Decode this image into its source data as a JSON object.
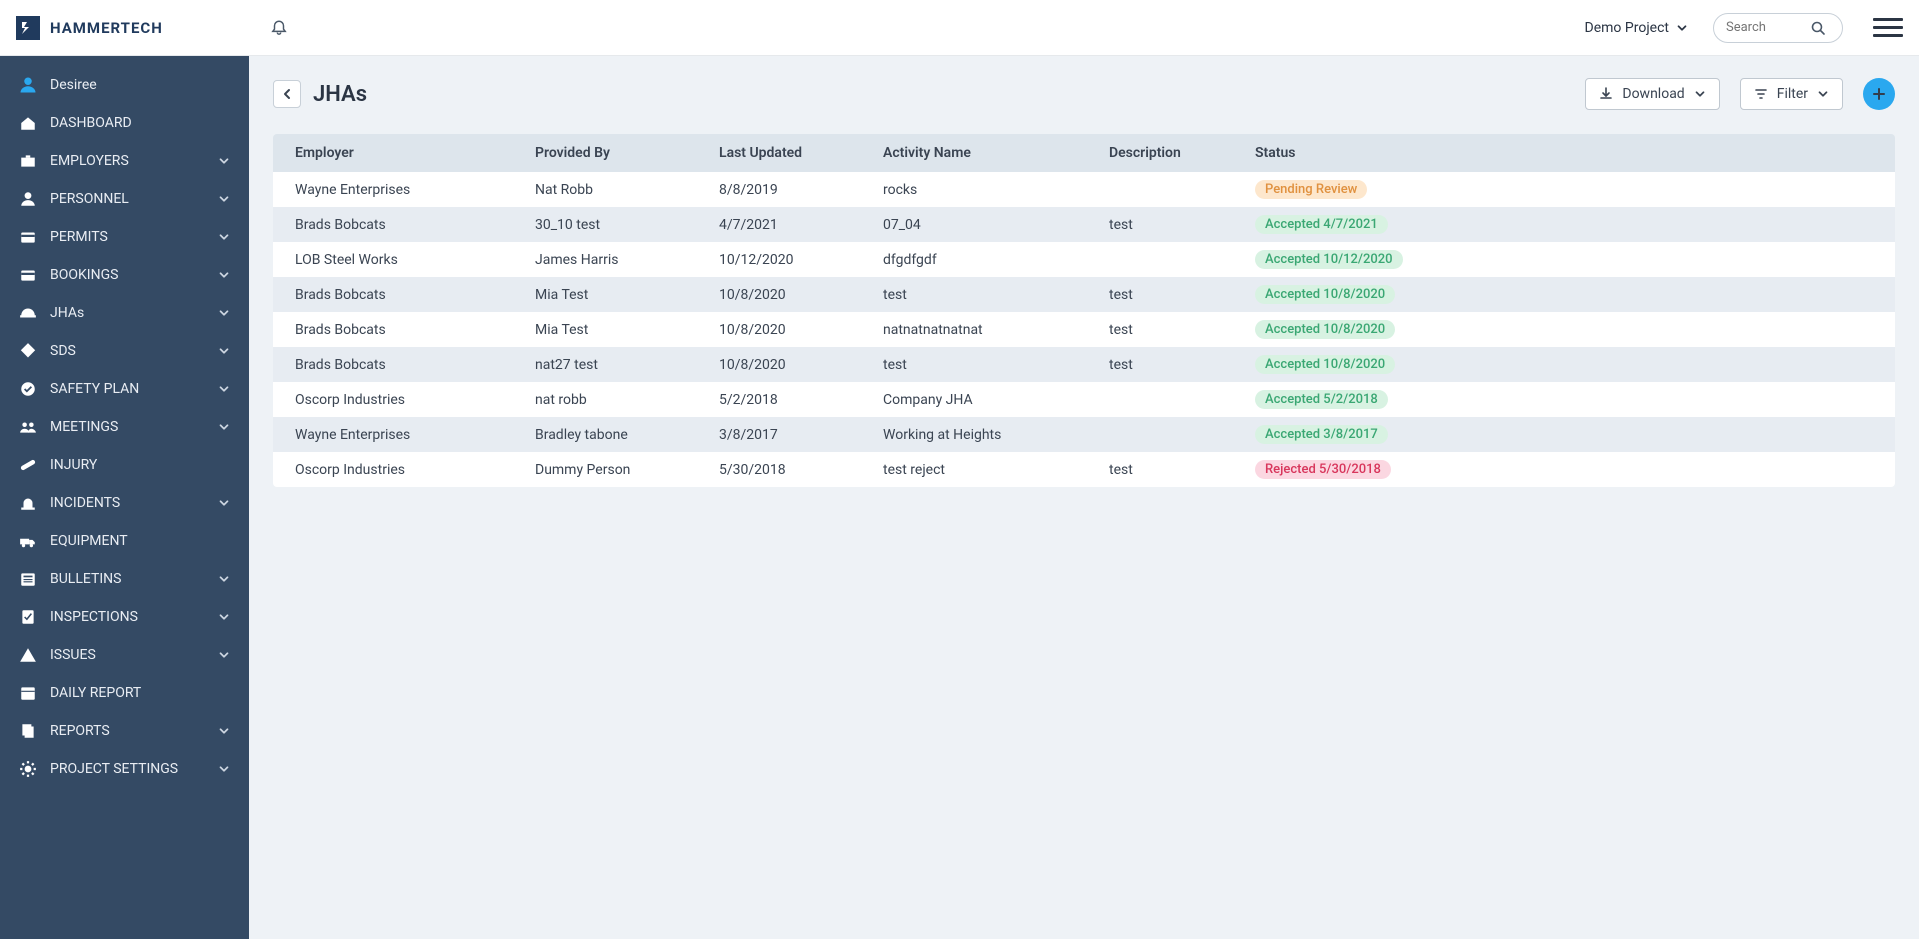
{
  "brand": "HAMMERTECH",
  "project_switch": "Demo Project",
  "search_placeholder": "Search",
  "user_name": "Desiree",
  "sidebar": [
    {
      "icon": "dashboard",
      "label": "DASHBOARD",
      "expandable": false
    },
    {
      "icon": "briefcase",
      "label": "EMPLOYERS",
      "expandable": true
    },
    {
      "icon": "person",
      "label": "PERSONNEL",
      "expandable": true
    },
    {
      "icon": "card",
      "label": "PERMITS",
      "expandable": true
    },
    {
      "icon": "card",
      "label": "BOOKINGS",
      "expandable": true
    },
    {
      "icon": "hardhat",
      "label": "JHAs",
      "expandable": true
    },
    {
      "icon": "diamond",
      "label": "SDS",
      "expandable": true
    },
    {
      "icon": "check-circle",
      "label": "SAFETY PLAN",
      "expandable": true
    },
    {
      "icon": "group",
      "label": "MEETINGS",
      "expandable": true
    },
    {
      "icon": "bandage",
      "label": "INJURY",
      "expandable": false
    },
    {
      "icon": "siren",
      "label": "INCIDENTS",
      "expandable": true
    },
    {
      "icon": "truck",
      "label": "EQUIPMENT",
      "expandable": false
    },
    {
      "icon": "newspaper",
      "label": "BULLETINS",
      "expandable": true
    },
    {
      "icon": "clipboard-check",
      "label": "INSPECTIONS",
      "expandable": true
    },
    {
      "icon": "warning",
      "label": "ISSUES",
      "expandable": true
    },
    {
      "icon": "calendar",
      "label": "DAILY REPORT",
      "expandable": false
    },
    {
      "icon": "files",
      "label": "REPORTS",
      "expandable": true
    },
    {
      "icon": "gear",
      "label": "PROJECT SETTINGS",
      "expandable": true
    }
  ],
  "page": {
    "title": "JHAs",
    "download_label": "Download",
    "filter_label": "Filter"
  },
  "table": {
    "columns": [
      "Employer",
      "Provided By",
      "Last Updated",
      "Activity Name",
      "Description",
      "Status"
    ],
    "rows": [
      {
        "employer": "Wayne Enterprises",
        "provided_by": "Nat Robb",
        "last_updated": "8/8/2019",
        "activity": "rocks",
        "description": "",
        "status": {
          "kind": "pending",
          "label": "Pending Review"
        }
      },
      {
        "employer": "Brads Bobcats",
        "provided_by": "30_10 test",
        "last_updated": "4/7/2021",
        "activity": "07_04",
        "description": "test",
        "status": {
          "kind": "accepted",
          "label": "Accepted 4/7/2021"
        }
      },
      {
        "employer": "LOB Steel Works",
        "provided_by": "James Harris",
        "last_updated": "10/12/2020",
        "activity": "dfgdfgdf",
        "description": "",
        "status": {
          "kind": "accepted",
          "label": "Accepted 10/12/2020"
        }
      },
      {
        "employer": "Brads Bobcats",
        "provided_by": "Mia Test",
        "last_updated": "10/8/2020",
        "activity": "test",
        "description": "test",
        "status": {
          "kind": "accepted",
          "label": "Accepted 10/8/2020"
        }
      },
      {
        "employer": "Brads Bobcats",
        "provided_by": "Mia Test",
        "last_updated": "10/8/2020",
        "activity": "natnatnatnatnat",
        "description": "test",
        "status": {
          "kind": "accepted",
          "label": "Accepted 10/8/2020"
        }
      },
      {
        "employer": "Brads Bobcats",
        "provided_by": "nat27 test",
        "last_updated": "10/8/2020",
        "activity": "test",
        "description": "test",
        "status": {
          "kind": "accepted",
          "label": "Accepted 10/8/2020"
        }
      },
      {
        "employer": "Oscorp Industries",
        "provided_by": "nat robb",
        "last_updated": "5/2/2018",
        "activity": "Company JHA",
        "description": "",
        "status": {
          "kind": "accepted",
          "label": "Accepted 5/2/2018"
        }
      },
      {
        "employer": "Wayne Enterprises",
        "provided_by": "Bradley tabone",
        "last_updated": "3/8/2017",
        "activity": "Working at Heights",
        "description": "",
        "status": {
          "kind": "accepted",
          "label": "Accepted 3/8/2017"
        }
      },
      {
        "employer": "Oscorp Industries",
        "provided_by": "Dummy Person",
        "last_updated": "5/30/2018",
        "activity": "test reject",
        "description": "test",
        "status": {
          "kind": "rejected",
          "label": "Rejected 5/30/2018"
        }
      }
    ]
  }
}
